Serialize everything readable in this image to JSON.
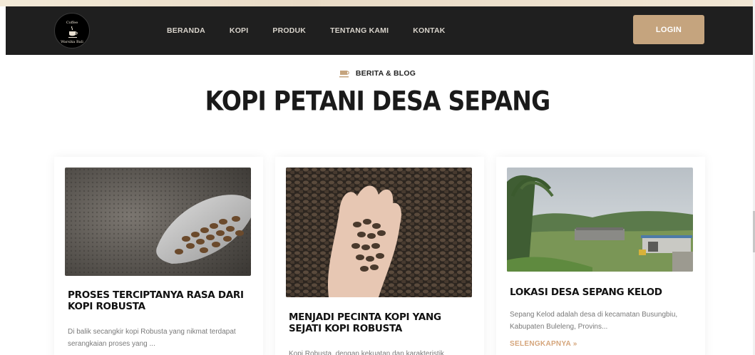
{
  "navbar": {
    "logo": {
      "line1": "Coffee",
      "line2": "Warsika Bali",
      "icon": "coffee-cup-icon"
    },
    "items": [
      {
        "label": "BERANDA"
      },
      {
        "label": "KOPI"
      },
      {
        "label": "PRODUK"
      },
      {
        "label": "TENTANG KAMI"
      },
      {
        "label": "KONTAK"
      }
    ],
    "login_label": "LOGIN"
  },
  "section": {
    "kicker_icon": "coffee-cup-icon",
    "kicker": "BERITA & BLOG",
    "title": "KOPI PETANI DESA SEPANG"
  },
  "cards": [
    {
      "image": "roasted-beans-scoop-photo",
      "title": "PROSES TERCIPTANYA RASA DARI KOPI ROBUSTA",
      "excerpt": "Di balik secangkir kopi Robusta yang nikmat terdapat serangkaian proses yang ..."
    },
    {
      "image": "hand-holding-beans-photo",
      "title": "MENJADI PECINTA KOPI YANG SEJATI KOPI ROBUSTA",
      "excerpt": "Kopi Robusta, dengan kekuatan dan karakteristik"
    },
    {
      "image": "village-landscape-photo",
      "title": "LOKASI DESA SEPANG KELOD",
      "excerpt": "Sepang Kelod adalah desa di kecamatan Busungbiu, Kabupaten Buleleng, Provins...",
      "more": "SELENGKAPNYA »"
    }
  ],
  "colors": {
    "accent": "#c5a47e",
    "navbar": "#1f1f1f",
    "link": "#d5a57b"
  }
}
